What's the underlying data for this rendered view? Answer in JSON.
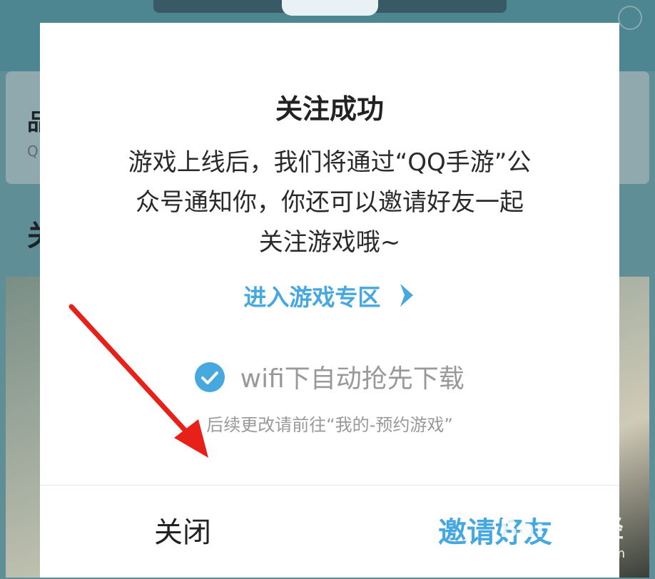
{
  "background": {
    "card_title": "品",
    "card_sub": "Q",
    "section_heading": "关"
  },
  "dialog": {
    "title": "关注成功",
    "message_line1": "游戏上线后，我们将通过“QQ手游”公",
    "message_line2": "众号通知你，你还可以邀请好友一起",
    "message_line3": "关注游戏哦~",
    "enter_link": "进入游戏专区",
    "wifi_option": "wifi下自动抢先下载",
    "wifi_checked": true,
    "hint": "后续更改请前往“我的-预约游戏”",
    "close_button": "关闭",
    "invite_button": "邀请好友"
  },
  "watermark": {
    "logo": "Bai du 经验",
    "url": "jingyan.baidu.com"
  },
  "colors": {
    "accent": "#46a8de",
    "overlay": "#5f8e97",
    "arrow": "#e8201a"
  }
}
